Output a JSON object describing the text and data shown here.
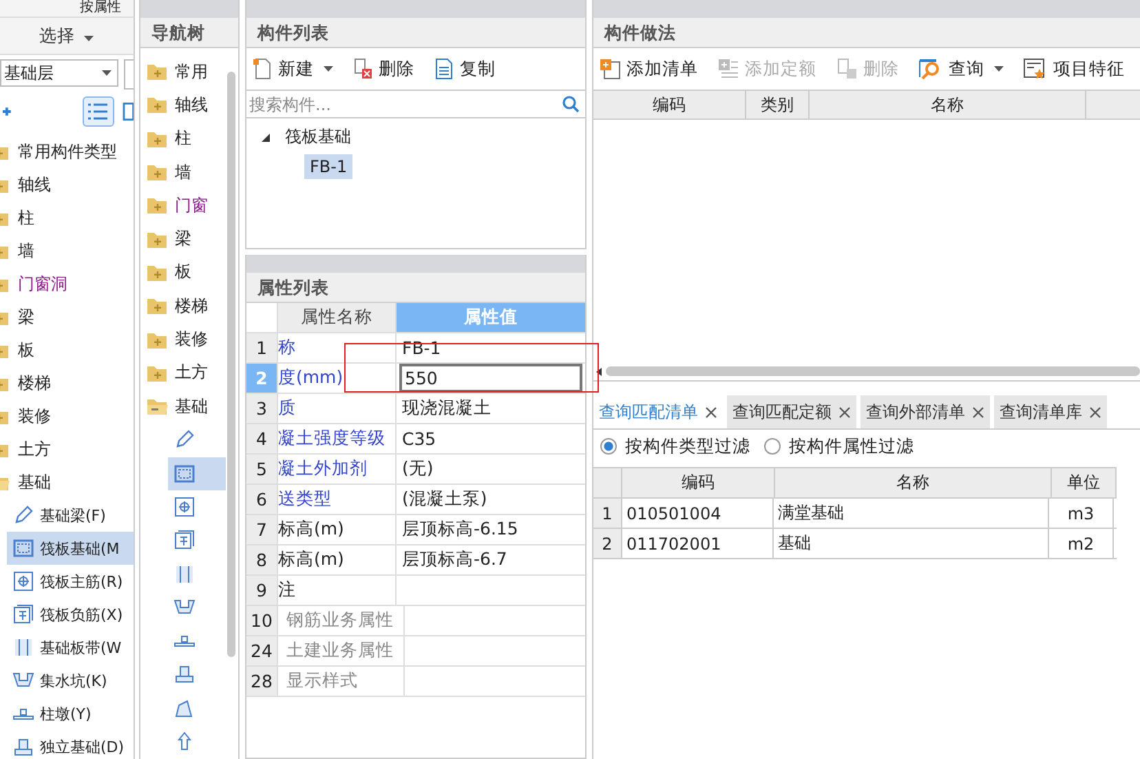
{
  "left_panel": {
    "top_label": "按属性",
    "select_button": "选择",
    "floor_select": "基础层",
    "tree": [
      {
        "label": "常用构件类型",
        "expanded": false
      },
      {
        "label": "轴线",
        "expanded": false
      },
      {
        "label": "柱",
        "expanded": false
      },
      {
        "label": "墙",
        "expanded": false
      },
      {
        "label": "门窗洞",
        "expanded": false
      },
      {
        "label": "梁",
        "expanded": false
      },
      {
        "label": "板",
        "expanded": false
      },
      {
        "label": "楼梯",
        "expanded": false
      },
      {
        "label": "装修",
        "expanded": false
      },
      {
        "label": "土方",
        "expanded": false
      },
      {
        "label": "基础",
        "expanded": true,
        "children": [
          {
            "label": "基础梁(F)",
            "selected": false
          },
          {
            "label": "筏板基础(M",
            "selected": true
          },
          {
            "label": "筏板主筋(R)",
            "selected": false
          },
          {
            "label": "筏板负筋(X)",
            "selected": false
          },
          {
            "label": "基础板带(W",
            "selected": false
          },
          {
            "label": "集水坑(K)",
            "selected": false
          },
          {
            "label": "柱墩(Y)",
            "selected": false
          },
          {
            "label": "独立基础(D)",
            "selected": false
          }
        ]
      }
    ]
  },
  "nav_tree": {
    "title": "导航树",
    "items": [
      {
        "label": "常用",
        "expanded": false
      },
      {
        "label": "轴线",
        "expanded": false
      },
      {
        "label": "柱",
        "expanded": false
      },
      {
        "label": "墙",
        "expanded": false
      },
      {
        "label": "门窗",
        "expanded": false
      },
      {
        "label": "梁",
        "expanded": false
      },
      {
        "label": "板",
        "expanded": false
      },
      {
        "label": "楼梯",
        "expanded": false
      },
      {
        "label": "装修",
        "expanded": false
      },
      {
        "label": "土方",
        "expanded": false
      },
      {
        "label": "基础",
        "expanded": true,
        "children": [
          {
            "selected": false
          },
          {
            "selected": true
          },
          {
            "selected": false
          },
          {
            "selected": false
          },
          {
            "selected": false
          },
          {
            "selected": false
          },
          {
            "selected": false
          },
          {
            "selected": false
          },
          {
            "selected": false
          },
          {
            "selected": false
          }
        ]
      }
    ]
  },
  "component_list": {
    "title": "构件列表",
    "toolbar": [
      "新建",
      "删除",
      "复制"
    ],
    "search": {
      "placeholder": "搜索构件..."
    },
    "tree": [
      {
        "label": "筏板基础",
        "expanded": true,
        "children": [
          {
            "label": "FB-1",
            "selected": true
          }
        ]
      }
    ]
  },
  "property_list": {
    "title": "属性列表",
    "columns": [
      "属性名称",
      "属性值"
    ],
    "rows": [
      {
        "index": "1",
        "name": "称",
        "value": "FB-1",
        "kind": "public",
        "selected": false
      },
      {
        "index": "2",
        "name": "度(mm)",
        "value": "550",
        "kind": "public",
        "selected": true
      },
      {
        "index": "3",
        "name": "质",
        "value": "现浇混凝土",
        "kind": "public",
        "selected": false
      },
      {
        "index": "4",
        "name": "凝土强度等级",
        "value": "C35",
        "kind": "public",
        "selected": false
      },
      {
        "index": "5",
        "name": "凝土外加剂",
        "value": "(无)",
        "kind": "public",
        "selected": false
      },
      {
        "index": "6",
        "name": "送类型",
        "value": "(混凝土泵)",
        "kind": "public",
        "selected": false
      },
      {
        "index": "7",
        "name": "标高(m)",
        "value": "层顶标高-6.15",
        "kind": "private",
        "selected": false
      },
      {
        "index": "8",
        "name": "标高(m)",
        "value": "层顶标高-6.7",
        "kind": "private",
        "selected": false
      },
      {
        "index": "9",
        "name": "注",
        "kind": "private",
        "selected": false
      },
      {
        "index": "10",
        "name": "钢筋业务属性",
        "kind": "group",
        "selected": false
      },
      {
        "index": "24",
        "name": "土建业务属性",
        "kind": "group",
        "selected": false
      },
      {
        "index": "28",
        "name": "显示样式",
        "kind": "group",
        "selected": false
      }
    ]
  },
  "method_panel": {
    "title": "构件做法",
    "toolbar": [
      {
        "label": "添加清单",
        "disabled": false
      },
      {
        "label": "添加定额",
        "disabled": true
      },
      {
        "label": "删除",
        "disabled": true
      },
      {
        "label": "查询",
        "disabled": false
      },
      {
        "label": "项目特征",
        "disabled": false
      }
    ],
    "columns": [
      "编码",
      "类别",
      "名称"
    ]
  },
  "query": {
    "tabs": [
      {
        "label": "查询匹配清单",
        "selected": true
      },
      {
        "label": "查询匹配定额",
        "selected": false
      },
      {
        "label": "查询外部清单",
        "selected": false
      },
      {
        "label": "查询清单库",
        "selected": false
      }
    ],
    "filters": [
      {
        "label": "按构件类型过滤",
        "selected": true
      },
      {
        "label": "按构件属性过滤",
        "selected": false
      }
    ],
    "columns": [
      "编码",
      "名称",
      "单位"
    ],
    "rows": [
      {
        "index": "1",
        "code": "010501004",
        "name": "满堂基础",
        "unit": "m3"
      },
      {
        "index": "2",
        "code": "011702001",
        "name": "基础",
        "unit": "m2"
      }
    ]
  }
}
